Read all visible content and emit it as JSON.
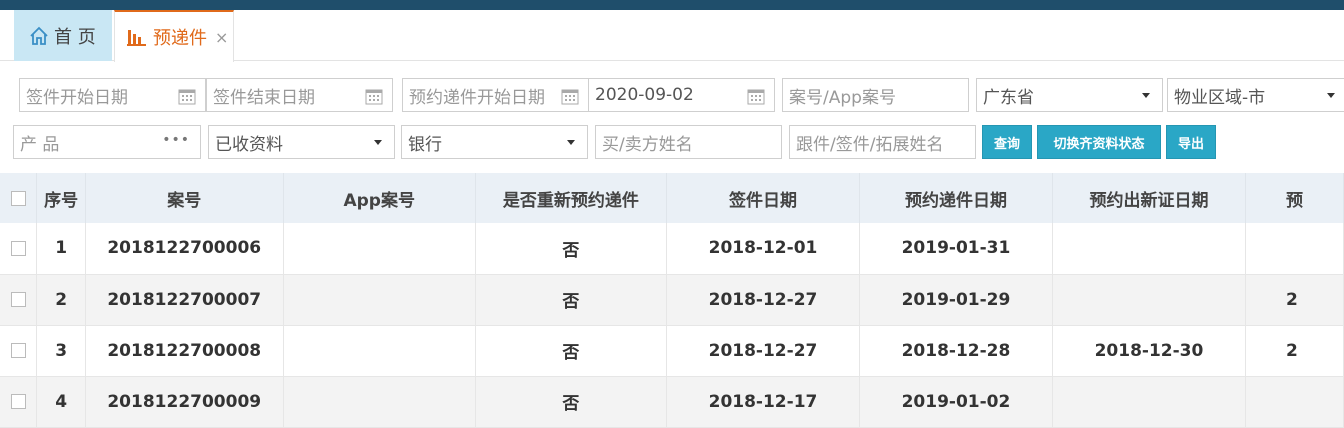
{
  "tabs": {
    "home_label": "首 页",
    "active_label": "预递件",
    "close_glyph": "×"
  },
  "filters": {
    "sign_start_date": "签件开始日期",
    "sign_end_date": "签件结束日期",
    "appt_start_date": "预约递件开始日期",
    "appt_end_date": "2020-09-02",
    "case_no": "案号/App案号",
    "province": "广东省",
    "city": "物业区域-市",
    "product": "产 品",
    "received_docs": "已收资料",
    "bank": "银行",
    "buyer_seller_name": "买/卖方姓名",
    "followup_name": "跟件/签件/拓展姓名"
  },
  "buttons": {
    "search": "查询",
    "toggle": "切换齐资料状态",
    "export": "导出"
  },
  "table": {
    "headers": [
      "序号",
      "案号",
      "App案号",
      "是否重新预约递件",
      "签件日期",
      "预约递件日期",
      "预约出新证日期",
      "预"
    ],
    "rows": [
      {
        "no": "1",
        "case": "2018122700006",
        "app": "",
        "rebook": "否",
        "sign": "2018-12-01",
        "appt": "2019-01-31",
        "newcert": "",
        "last": ""
      },
      {
        "no": "2",
        "case": "2018122700007",
        "app": "",
        "rebook": "否",
        "sign": "2018-12-27",
        "appt": "2019-01-29",
        "newcert": "",
        "last": "2"
      },
      {
        "no": "3",
        "case": "2018122700008",
        "app": "",
        "rebook": "否",
        "sign": "2018-12-27",
        "appt": "2018-12-28",
        "newcert": "2018-12-30",
        "last": "2"
      },
      {
        "no": "4",
        "case": "2018122700009",
        "app": "",
        "rebook": "否",
        "sign": "2018-12-17",
        "appt": "2019-01-02",
        "newcert": "",
        "last": ""
      }
    ]
  },
  "colors": {
    "accent_orange": "#e06a1b",
    "button_teal": "#2aa7c6",
    "topbar": "#1f4e6b"
  }
}
